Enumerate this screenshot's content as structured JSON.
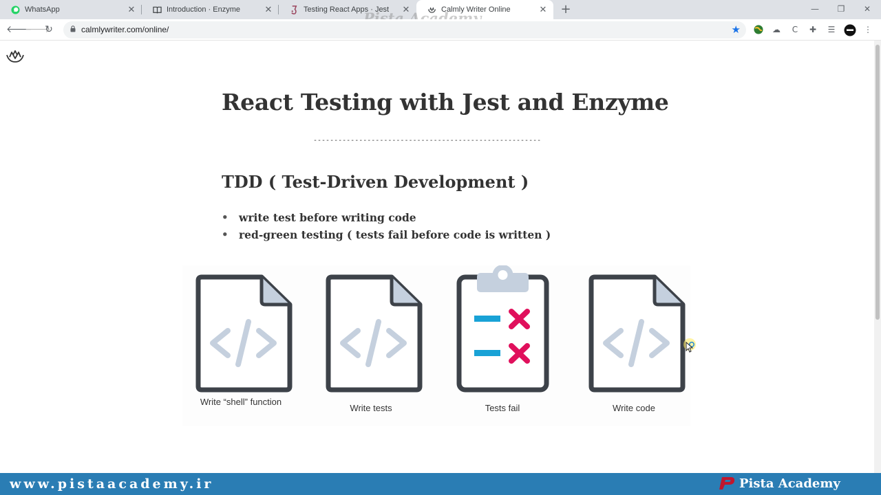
{
  "browser": {
    "tabs": [
      {
        "label": "WhatsApp",
        "icon": "whatsapp-icon",
        "active": false
      },
      {
        "label": "Introduction · Enzyme",
        "icon": "book-icon",
        "active": false
      },
      {
        "label": "Testing React Apps · Jest",
        "icon": "jest-icon",
        "active": false
      },
      {
        "label": "Calmly Writer Online",
        "icon": "lotus-icon",
        "active": true
      }
    ],
    "url": "calmlywriter.com/online/",
    "watermark": "Pista Academy"
  },
  "document": {
    "title": "React Testing with Jest and Enzyme",
    "divider": "--------------------------------------------------------------",
    "subtitle": "TDD ( Test-Driven Development )",
    "bullets": [
      "write test before writing code",
      "red-green testing ( tests fail before code is written )"
    ],
    "figure": {
      "steps": [
        {
          "caption": "Write “shell” function",
          "icon": "code-file-icon"
        },
        {
          "caption": "Write tests",
          "icon": "code-file-icon"
        },
        {
          "caption": "Tests fail",
          "icon": "clipboard-fail-icon"
        },
        {
          "caption": "Write code",
          "icon": "code-file-icon"
        }
      ]
    }
  },
  "footer": {
    "website": "www.pistaacademy.ir",
    "brand": "Pista Academy"
  },
  "colors": {
    "accent": "#1a73e8",
    "icon_dark": "#3d4249",
    "icon_light": "#c5d0de",
    "fail_red": "#e0105c",
    "dash_blue": "#19a2d6",
    "footer_bg": "#2a7db4"
  }
}
